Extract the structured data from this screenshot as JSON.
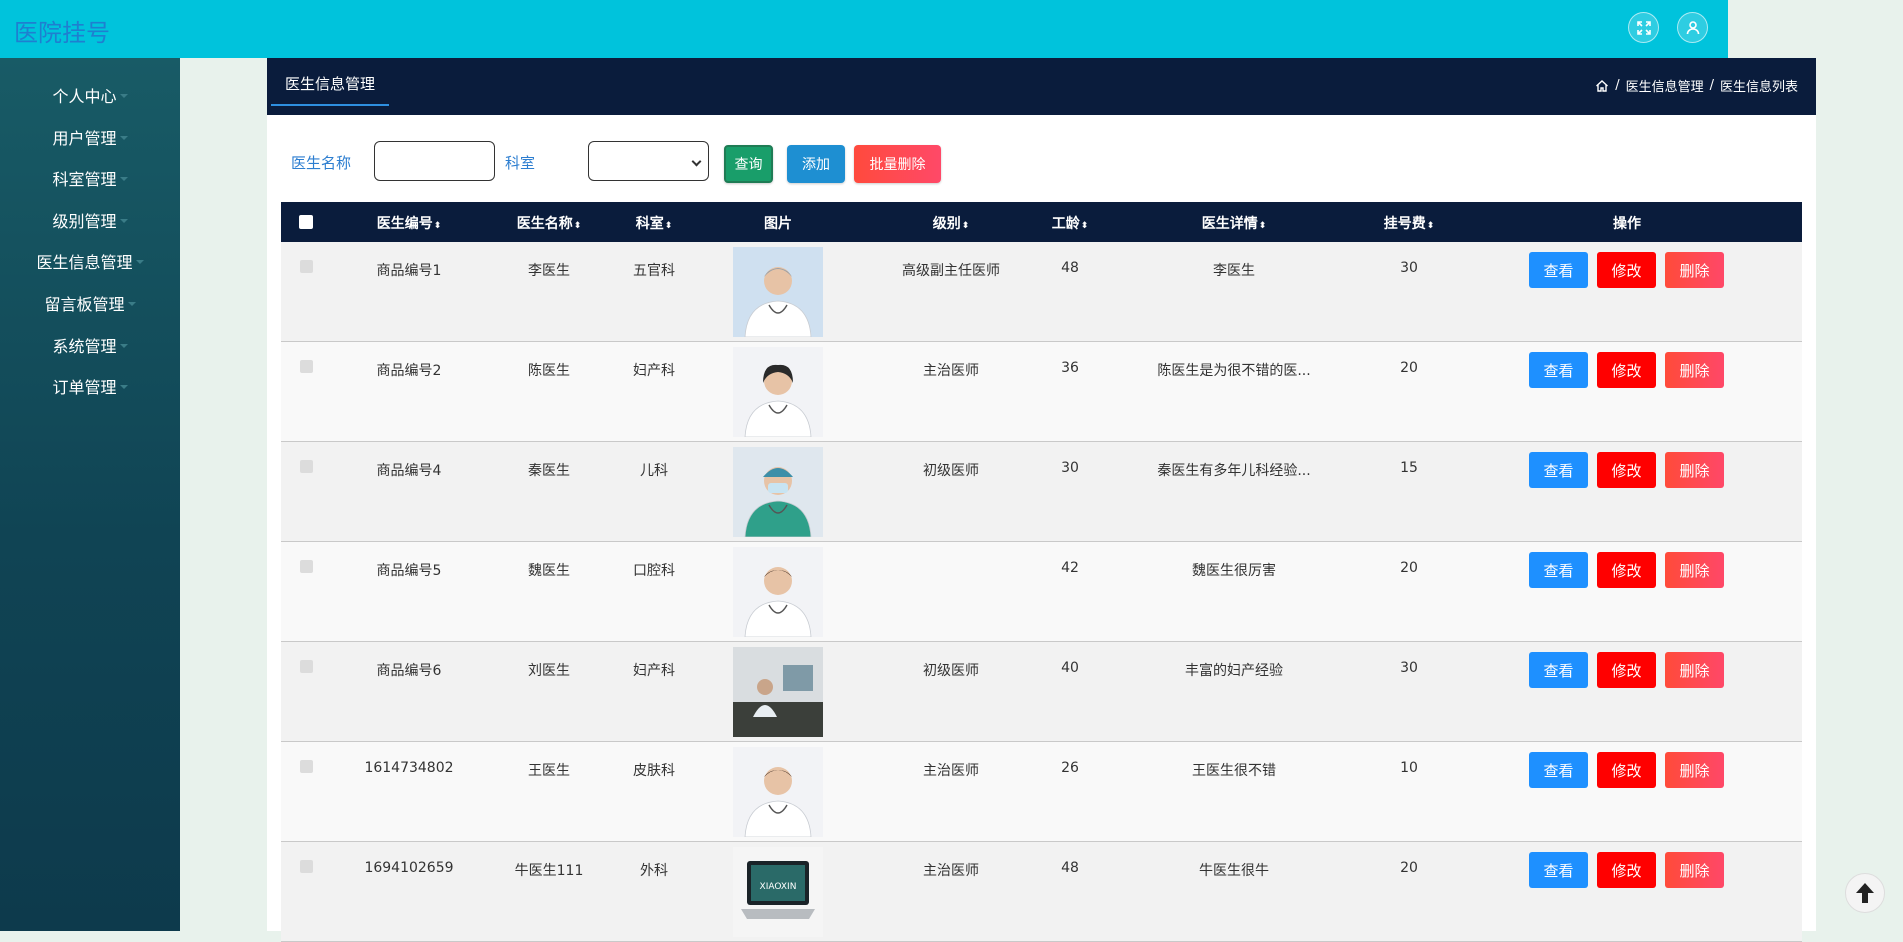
{
  "app": {
    "title": "医院挂号"
  },
  "sidebar": {
    "items": [
      {
        "label": "个人中心"
      },
      {
        "label": "用户管理"
      },
      {
        "label": "科室管理"
      },
      {
        "label": "级别管理"
      },
      {
        "label": "医生信息管理"
      },
      {
        "label": "留言板管理"
      },
      {
        "label": "系统管理"
      },
      {
        "label": "订单管理"
      }
    ]
  },
  "panel": {
    "tab": "医生信息管理",
    "breadcrumb": [
      "医生信息管理",
      "医生信息列表"
    ],
    "breadcrumb_sep": "/"
  },
  "search": {
    "name_label": "医生名称",
    "name_value": "",
    "dept_label": "科室",
    "dept_value": "",
    "query_label": "查询",
    "add_label": "添加",
    "bulk_delete_label": "批量删除"
  },
  "table": {
    "headers": {
      "id": "医生编号",
      "name": "医生名称",
      "dept": "科室",
      "photo": "图片",
      "level": "级别",
      "age": "工龄",
      "detail": "医生详情",
      "fee": "挂号费",
      "ops": "操作"
    },
    "sort_glyph": "⬍",
    "actions": {
      "view": "查看",
      "edit": "修改",
      "delete": "删除"
    },
    "rows": [
      {
        "id": "商品编号1",
        "name": "李医生",
        "dept": "五官科",
        "level": "高级副主任医师",
        "age": "48",
        "detail": "李医生",
        "fee": "30",
        "photo": "doctor-male-gray-hair"
      },
      {
        "id": "商品编号2",
        "name": "陈医生",
        "dept": "妇产科",
        "level": "主治医师",
        "age": "36",
        "detail": "陈医生是为很不错的医...",
        "fee": "20",
        "photo": "doctor-female-stethoscope"
      },
      {
        "id": "商品编号4",
        "name": "秦医生",
        "dept": "儿科",
        "level": "初级医师",
        "age": "30",
        "detail": "秦医生有多年儿科经验...",
        "fee": "15",
        "photo": "surgeon-green-scrubs"
      },
      {
        "id": "商品编号5",
        "name": "魏医生",
        "dept": "口腔科",
        "level": "",
        "age": "42",
        "detail": "魏医生很厉害",
        "fee": "20",
        "photo": "doctor-male-arms-crossed"
      },
      {
        "id": "商品编号6",
        "name": "刘医生",
        "dept": "妇产科",
        "level": "初级医师",
        "age": "40",
        "detail": "丰富的妇产经验",
        "fee": "30",
        "photo": "doctor-office-desk"
      },
      {
        "id": "1614734802",
        "name": "王医生",
        "dept": "皮肤科",
        "level": "主治医师",
        "age": "26",
        "detail": "王医生很不错",
        "fee": "10",
        "photo": "doctor-young-male"
      },
      {
        "id": "1694102659",
        "name": "牛医生111",
        "dept": "外科",
        "level": "主治医师",
        "age": "48",
        "detail": "牛医生很牛",
        "fee": "20",
        "photo": "laptop-xiaoxin",
        "photo_text": "XIAOXIN"
      }
    ]
  },
  "colors": {
    "topbar": "#00c3dc",
    "sidebar": "#104454",
    "panel_header": "#0a1c3c",
    "view_button": "#1e90ff",
    "edit_button": "#ff0000",
    "delete_button": "#ff4b3a"
  },
  "icons": {
    "expand": "expand-icon",
    "user": "user-icon",
    "home": "home-icon",
    "scroll_top": "arrow-up-icon"
  }
}
